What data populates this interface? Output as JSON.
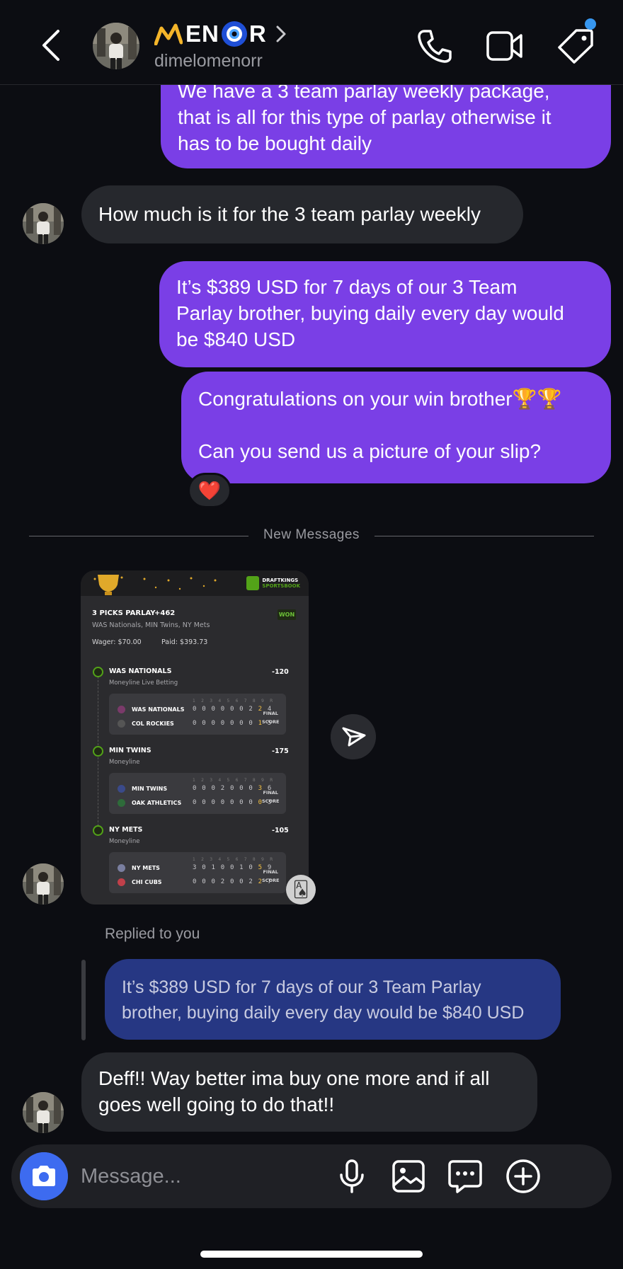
{
  "header": {
    "display_name_letters": [
      "EN",
      "R"
    ],
    "username": "dimelomenorr"
  },
  "messages": [
    {
      "from": "me",
      "text_lines": [
        "We have a 3 team parlay weekly package,",
        "that is all for this type of parlay otherwise it",
        "has to be bought daily"
      ]
    },
    {
      "from": "them",
      "text": "How much is it for the 3 team parlay weekly"
    },
    {
      "from": "me",
      "text_lines": [
        "It’s $389 USD for 7 days of our 3 Team",
        "Parlay brother, buying daily every day would",
        "be $840 USD"
      ]
    },
    {
      "from": "me",
      "text_lines": [
        "Congratulations on your win brother🏆🏆",
        "",
        "Can you send us a picture of your slip?"
      ],
      "reaction": "❤️"
    }
  ],
  "new_messages_label": "New Messages",
  "bet_slip": {
    "brand_top": "DRAFTKINGS",
    "brand_bottom": "SPORTSBOOK",
    "title": "3 PICKS PARLAY",
    "odds": "+462",
    "teams": "WAS Nationals, MIN Twins, NY Mets",
    "status": "WON",
    "wager": "Wager: $70.00",
    "paid": "Paid: $393.73",
    "innings_header": "1 2 3 4 5 6 7 8 9 R",
    "final_label": "FINAL",
    "score_label": "SCORE",
    "legs": [
      {
        "team": "WAS NATIONALS",
        "market": "Moneyline Live Betting",
        "odds": "-120",
        "home": {
          "name": "WAS NATIONALS",
          "line": "0 0 0 0 0 0 2",
          "runs": "2",
          "total": "4"
        },
        "away": {
          "name": "COL ROCKIES",
          "line": "0 0 0 0 0 0 0",
          "runs": "1",
          "total": "5"
        }
      },
      {
        "team": "MIN TWINS",
        "market": "Moneyline",
        "odds": "-175",
        "home": {
          "name": "MIN TWINS",
          "line": "0 0 0 2 0 0 0",
          "runs": "3",
          "total": "6"
        },
        "away": {
          "name": "OAK ATHLETICS",
          "line": "0 0 0 0 0 0 0",
          "runs": "0",
          "total": "3"
        }
      },
      {
        "team": "NY METS",
        "market": "Moneyline",
        "odds": "-105",
        "home": {
          "name": "NY METS",
          "line": "3 0 1 0 0 1 0",
          "runs": "5",
          "total": "9"
        },
        "away": {
          "name": "CHI CUBS",
          "line": "0 0 0 2 0 0 2",
          "runs": "2",
          "total": "7"
        }
      }
    ]
  },
  "reply": {
    "label": "Replied to you",
    "quote_lines": [
      "It’s $389 USD for 7 days of our 3 Team Parlay",
      "brother, buying daily every day would be $840 USD"
    ]
  },
  "last_message": {
    "from": "them",
    "text_lines": [
      "Deff!! Way better ima buy one more and if all",
      "goes well going to do that!!"
    ]
  },
  "composer": {
    "placeholder": "Message..."
  },
  "colors": {
    "outgoing": "#7a3fe6",
    "incoming": "#26282d",
    "reply_quote": "#263783",
    "camera": "#3d6bf0",
    "notif_dot": "#3797f0"
  },
  "icons": [
    "back-chevron-icon",
    "crown-icon",
    "evil-eye-icon",
    "chevron-right-icon",
    "phone-icon",
    "video-icon",
    "tag-icon",
    "paper-plane-icon",
    "camera-icon",
    "microphone-icon",
    "image-icon",
    "sticker-chat-icon",
    "plus-circle-icon"
  ]
}
